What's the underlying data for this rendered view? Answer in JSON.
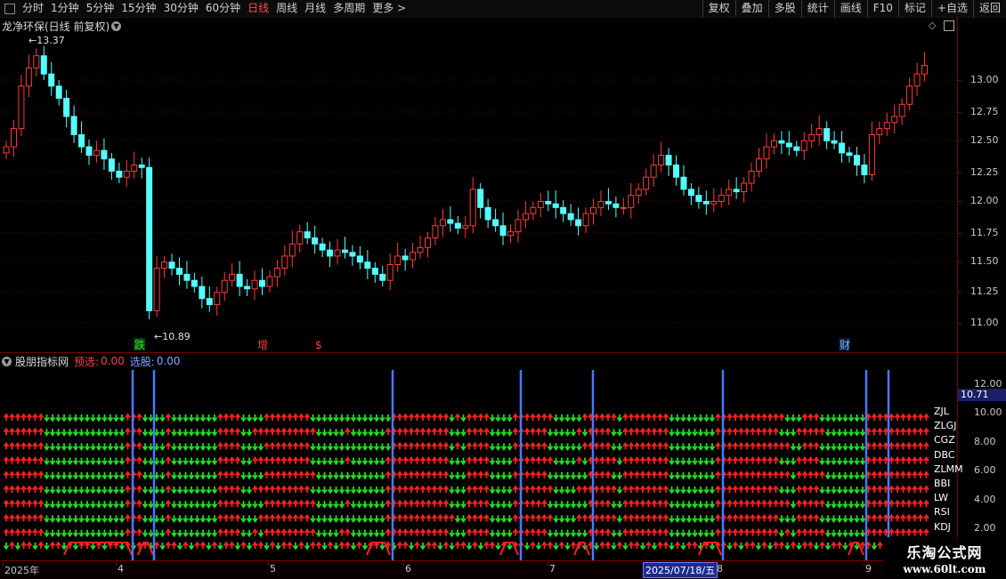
{
  "toolbar": {
    "left": [
      {
        "label": "分时",
        "active": false
      },
      {
        "label": "1分钟",
        "active": false
      },
      {
        "label": "5分钟",
        "active": false
      },
      {
        "label": "15分钟",
        "active": false
      },
      {
        "label": "30分钟",
        "active": false
      },
      {
        "label": "60分钟",
        "active": false
      },
      {
        "label": "日线",
        "active": true
      },
      {
        "label": "周线",
        "active": false
      },
      {
        "label": "月线",
        "active": false
      },
      {
        "label": "多周期",
        "active": false
      },
      {
        "label": "更多 >",
        "active": false
      }
    ],
    "right": [
      "复权",
      "叠加",
      "多股",
      "统计",
      "画线",
      "F10",
      "标记",
      "+自选",
      "返回"
    ]
  },
  "main_panel": {
    "title": "龙净环保(日线 前复权)",
    "high_label": "13.37",
    "low_label": "10.89",
    "price_ticks": [
      "13.00",
      "12.75",
      "12.50",
      "12.25",
      "12.00",
      "11.75",
      "11.50",
      "11.25",
      "11.00"
    ],
    "markers": [
      {
        "text": "跌",
        "color": "#2ee82e",
        "bg": "#0a3a0a"
      },
      {
        "text": "增",
        "color": "#ff3a3a",
        "bg": "#000"
      },
      {
        "text": "$",
        "color": "#ff3a3a",
        "bg": "#000"
      },
      {
        "text": "财",
        "color": "#7fb8ff",
        "bg": "#0a1a3a"
      }
    ]
  },
  "indicator_panel": {
    "name": "股朋指标网",
    "prefilter_label": "预选:",
    "prefilter_value": "0.00",
    "select_label": "选股:",
    "select_value": "0.00",
    "value_box": "10.71",
    "value_ticks": [
      "12.00",
      "10.00",
      "8.00",
      "6.00",
      "4.00",
      "2.00"
    ],
    "rows": [
      "ZJL",
      "ZLGJ",
      "CGZ",
      "DBC",
      "ZLMM",
      "BBI",
      "LW",
      "RSI",
      "KDJ"
    ]
  },
  "date_axis": {
    "labels": [
      "2025年",
      "4",
      "5",
      "6",
      "7",
      "8",
      "9"
    ],
    "cursor_date": "2025/07/18/五"
  },
  "watermark": {
    "line1": "乐淘公式网",
    "line2": "www.60lt.com"
  },
  "colors": {
    "up": "#ff3b3b",
    "down": "#54ffff",
    "arrow_up": "#ff2020",
    "arrow_down": "#22dd22",
    "vline": "#4a78ff",
    "grid": "#7a0000"
  }
}
